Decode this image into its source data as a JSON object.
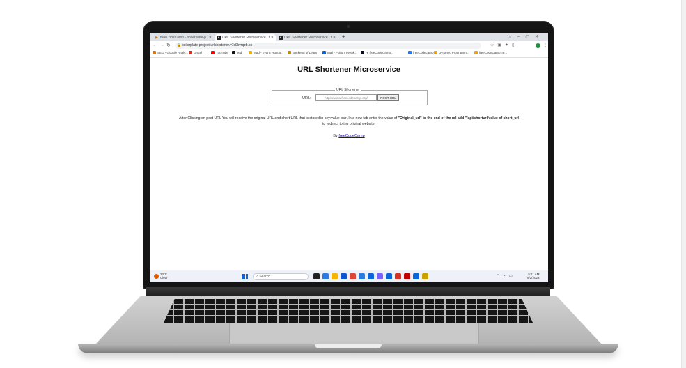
{
  "browser": {
    "tabs": [
      {
        "title": "freeCodeCamp - boilerplate-p",
        "favicon": "play-icon",
        "active": false
      },
      {
        "title": "URL Shortener Microservice | fre",
        "favicon": "fcc-icon",
        "active": true
      },
      {
        "title": "URL Shortener Microservice | fre",
        "favicon": "fcc-icon",
        "active": false
      }
    ],
    "address": "boilerplate-project-urlshortener.v7s9kvrqzb.co",
    "bookmarks": [
      {
        "label": "SEO - Google Analy...",
        "color": "#e37400"
      },
      {
        "label": "Gmail",
        "color": "#d93025"
      },
      {
        "label": "YouTube",
        "color": "#ff0000"
      },
      {
        "label": "Ted",
        "color": "#111111"
      },
      {
        "label": "Mad - Zvanz Rosca...",
        "color": "#f4b400"
      },
      {
        "label": "Backend of Learn",
        "color": "#c58a00"
      },
      {
        "label": "Mail - Fulton Tweak...",
        "color": "#0a66d8"
      },
      {
        "label": "Hi freeCodeCamp...",
        "color": "#0a0a23"
      },
      {
        "label": "freeCodecamp",
        "color": "#2a7ae2"
      },
      {
        "label": "Dynamic Programm...",
        "color": "#e8a317"
      },
      {
        "label": "freeCodeCamp Te...",
        "color": "#e8a317"
      }
    ]
  },
  "page": {
    "title": "URL Shortener Microservice",
    "form_legend": "URL Shortener",
    "url_label": "URL:",
    "url_placeholder": "https://www.freecodecamp.org/",
    "post_button": "POST URL",
    "desc_part1": "After Clicking on post URL You will receive the original URL and short URL that is stored in key:value pair. In a new tab enter the value of ",
    "desc_bold": "\"Original_url\" to the end of the url add \"/api/shorturl/value of short_url",
    "desc_part2": "to redirect to the original website.",
    "by_label": "By",
    "by_link": "freeCodeCamp"
  },
  "taskbar": {
    "weather_temp": "23°C",
    "weather_desc": "Clear",
    "search_label": "Search",
    "time": "5:11 AM",
    "date": "6/2/2023",
    "app_colors": [
      "#222222",
      "#2a7ae2",
      "#f4b400",
      "#0b57d0",
      "#db4437",
      "#2a7ae2",
      "#0a66d8",
      "#7b61ff",
      "#0a66d8",
      "#d93025",
      "#c00000",
      "#0a66d8",
      "#c8a000"
    ]
  }
}
